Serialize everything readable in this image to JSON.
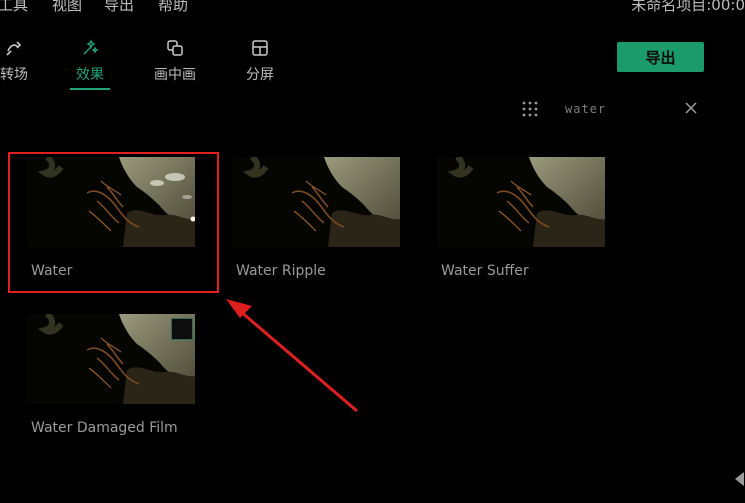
{
  "menu": {
    "items": [
      "工具",
      "视图",
      "导出",
      "帮助"
    ],
    "project_title": "未命名项目:00:0"
  },
  "toolbar": {
    "items": [
      {
        "label": "转场",
        "icon": "transition-icon"
      },
      {
        "label": "效果",
        "icon": "effects-icon",
        "active": true
      },
      {
        "label": "画中画",
        "icon": "pip-icon"
      },
      {
        "label": "分屏",
        "icon": "split-screen-icon"
      }
    ],
    "export_label": "导出"
  },
  "search": {
    "value": "water"
  },
  "effects": [
    {
      "label": "Water",
      "selected": true
    },
    {
      "label": "Water Ripple"
    },
    {
      "label": "Water Suffer"
    },
    {
      "label": "Water Damaged Film",
      "downloadable": true
    }
  ],
  "colors": {
    "accent": "#1b9b6b",
    "highlight": "#e02020",
    "background": "#000000"
  }
}
